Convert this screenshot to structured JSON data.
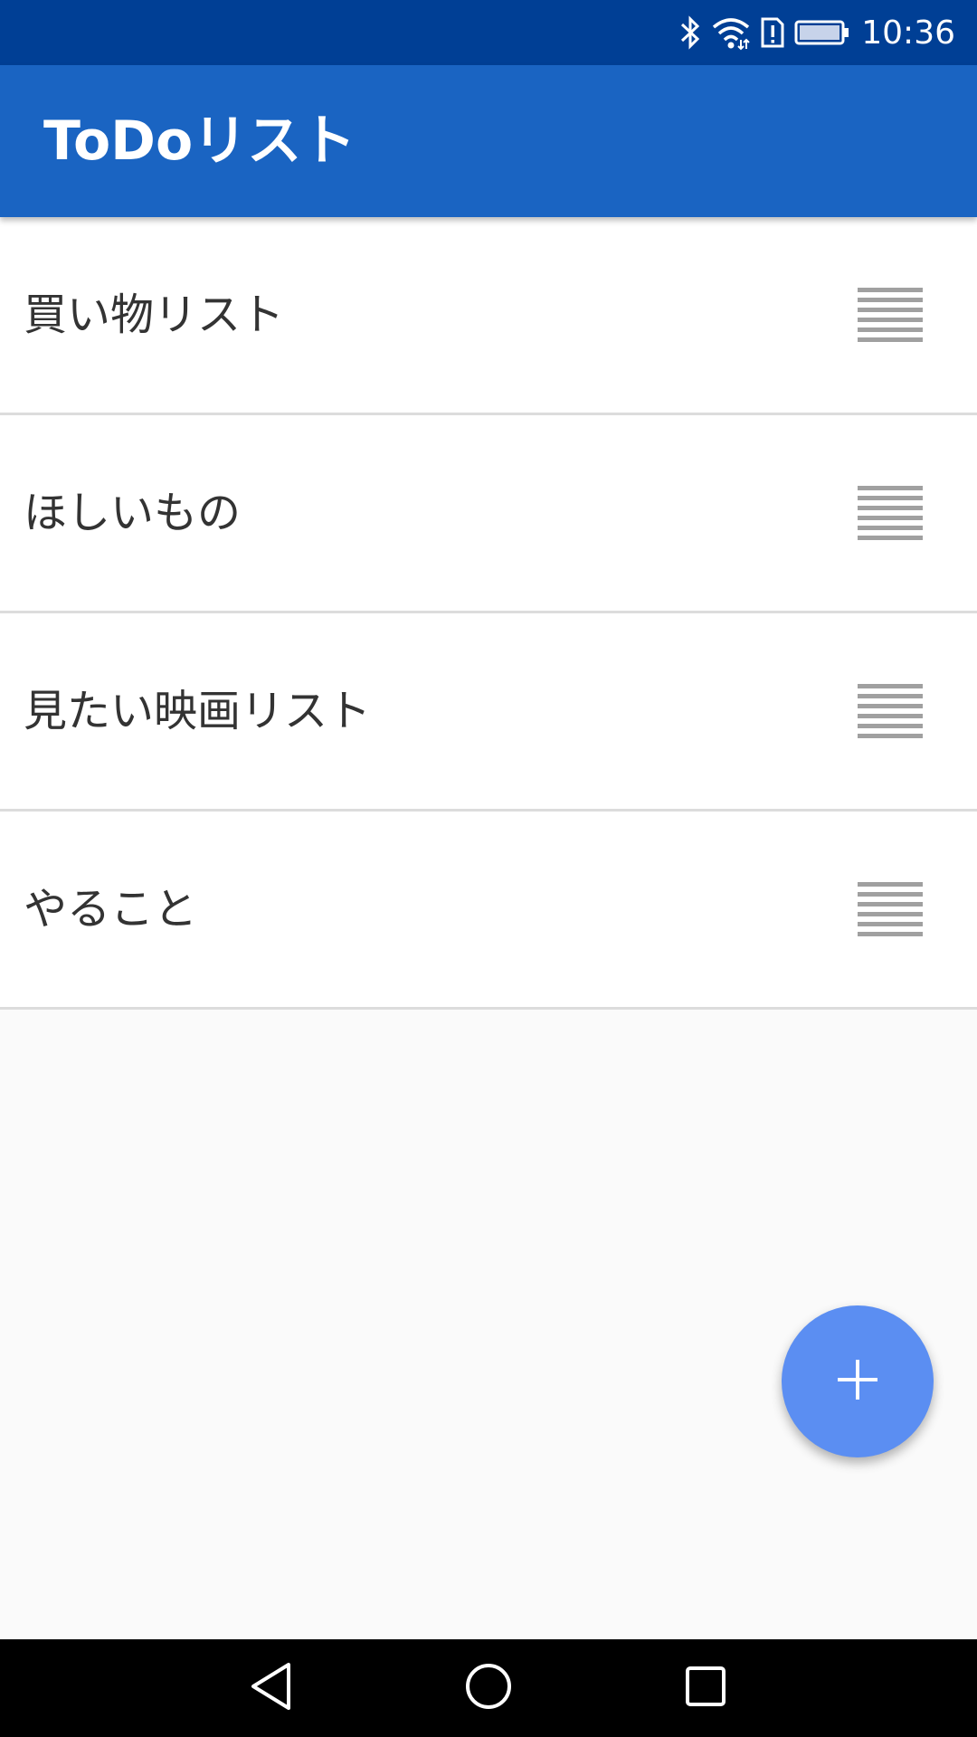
{
  "status_bar": {
    "time": "10:36",
    "icons": [
      "bluetooth-icon",
      "wifi-icon",
      "sim-alert-icon",
      "battery-icon"
    ]
  },
  "app_bar": {
    "title": "ToDoリスト"
  },
  "lists": [
    {
      "label": "買い物リスト",
      "icon": "drag-handle-icon"
    },
    {
      "label": "ほしいもの",
      "icon": "drag-handle-icon"
    },
    {
      "label": "見たい映画リスト",
      "icon": "drag-handle-icon"
    },
    {
      "label": "やること",
      "icon": "drag-handle-icon"
    }
  ],
  "fab": {
    "icon": "plus-icon"
  },
  "nav_bar": {
    "buttons": [
      "back-icon",
      "home-icon",
      "recents-icon"
    ]
  },
  "colors": {
    "status_bar": "#003f95",
    "app_bar": "#1a64c2",
    "fab": "#5b8ef2",
    "background": "#fafafa",
    "divider": "#dcdcdc",
    "drag_handle": "#a0a0a0"
  }
}
